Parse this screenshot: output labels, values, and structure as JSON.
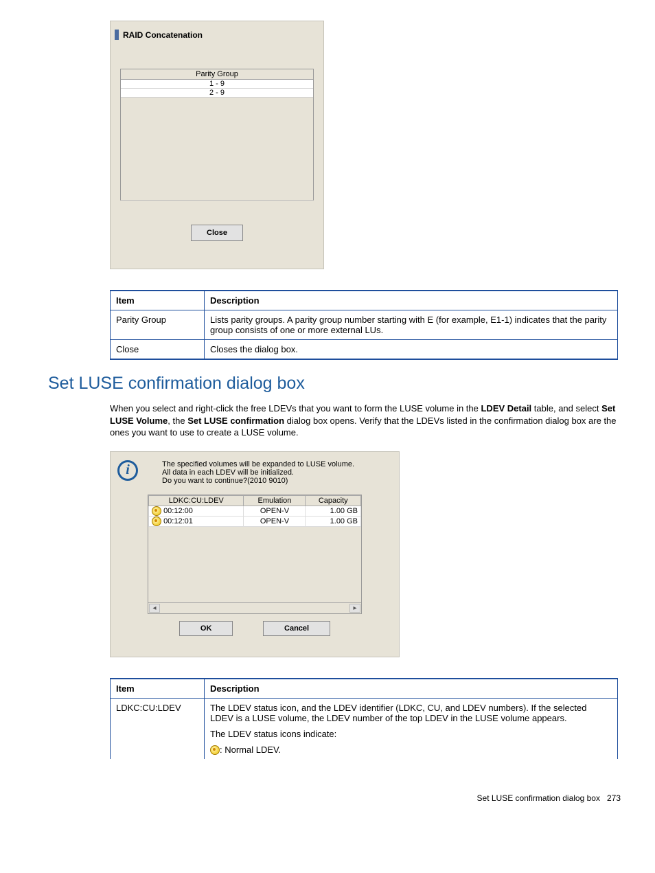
{
  "raid_dialog": {
    "title": "RAID Concatenation",
    "table_header": "Parity Group",
    "rows": [
      "1 - 9",
      "2 - 9"
    ],
    "close_label": "Close"
  },
  "desc_table1": {
    "headers": [
      "Item",
      "Description"
    ],
    "rows": [
      {
        "item": "Parity Group",
        "desc": "Lists parity groups. A parity group number starting with E (for example, E1-1) indicates that the parity group consists of one or more external LUs."
      },
      {
        "item": "Close",
        "desc": "Closes the dialog box."
      }
    ]
  },
  "section": {
    "title": "Set LUSE confirmation dialog box",
    "body_prefix": "When you select and right-click the free LDEVs that you want to form the LUSE volume in the ",
    "body_b1": "LDEV Detail",
    "body_mid1": " table, and select ",
    "body_b2": "Set LUSE Volume",
    "body_mid2": ", the ",
    "body_b3": "Set LUSE confirmation",
    "body_suffix": " dialog box opens. Verify that the LDEVs listed in the confirmation dialog box are the ones you want to use to create a LUSE volume."
  },
  "luse_dialog": {
    "msg1": "The specified volumes will be expanded to LUSE volume.",
    "msg2": "All data in each LDEV will be initialized.",
    "msg3": "Do you want to continue?(2010 9010)",
    "headers": [
      "LDKC:CU:LDEV",
      "Emulation",
      "Capacity"
    ],
    "rows": [
      {
        "id": "00:12:00",
        "emu": "OPEN-V",
        "cap": "1.00 GB"
      },
      {
        "id": "00:12:01",
        "emu": "OPEN-V",
        "cap": "1.00 GB"
      }
    ],
    "ok": "OK",
    "cancel": "Cancel"
  },
  "desc_table2": {
    "headers": [
      "Item",
      "Description"
    ],
    "rows": [
      {
        "item": "LDKC:CU:LDEV",
        "desc1": "The LDEV status icon, and the LDEV identifier (LDKC, CU, and LDEV numbers). If the selected LDEV is a LUSE volume, the LDEV number of the top LDEV in the LUSE volume appears.",
        "desc2": "The LDEV status icons indicate:",
        "icon_label": ": Normal LDEV."
      }
    ]
  },
  "footer": {
    "text": "Set LUSE confirmation dialog box",
    "pagenum": "273"
  }
}
